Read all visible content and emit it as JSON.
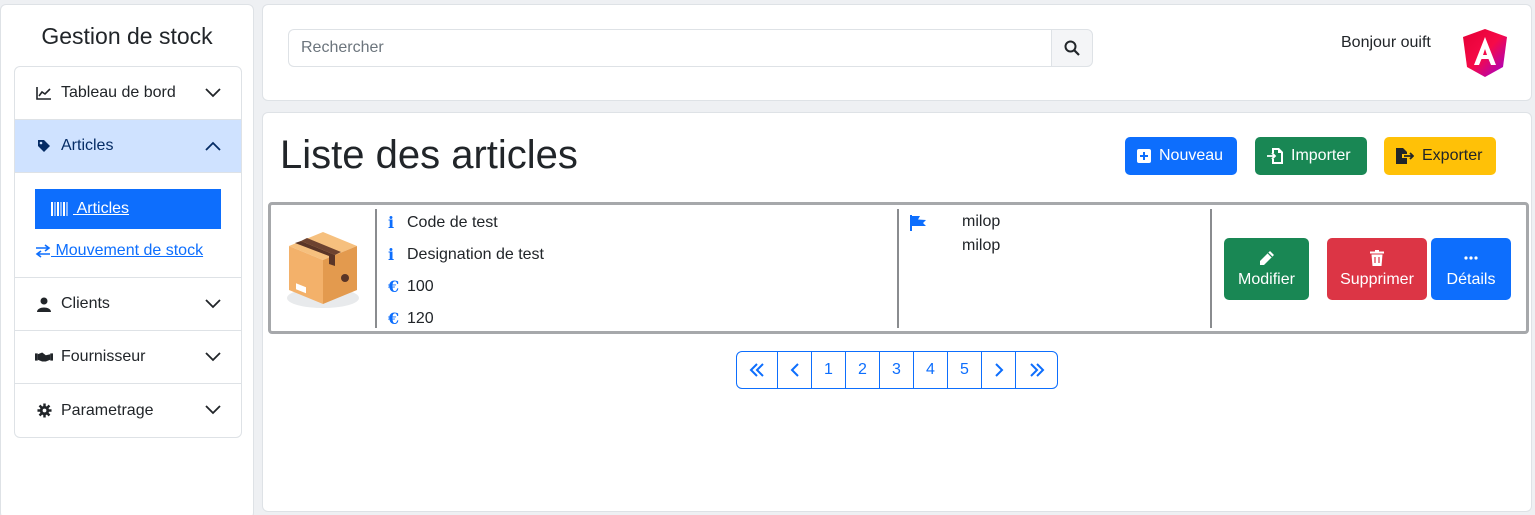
{
  "sidebar": {
    "brand": "Gestion de stock",
    "items": [
      {
        "label": "Tableau de bord"
      },
      {
        "label": "Articles"
      },
      {
        "label": "Clients"
      },
      {
        "label": "Fournisseur"
      },
      {
        "label": "Parametrage"
      }
    ],
    "sub": {
      "active_label": " Articles",
      "movement_label": " Mouvement de stock"
    }
  },
  "header": {
    "search_placeholder": "Rechercher",
    "greeting": "Bonjour ouift"
  },
  "main": {
    "title": "Liste des articles",
    "buttons": {
      "new": "Nouveau",
      "import": "Importer",
      "export": "Exporter"
    },
    "article": {
      "code": "Code de test",
      "designation": "Designation de test",
      "price1": "100",
      "price2": "120",
      "supplier1": "milop",
      "supplier2": "milop",
      "actions": {
        "edit": "Modifier",
        "delete": "Supprimer",
        "details": "Détails"
      }
    },
    "pagination": [
      "1",
      "2",
      "3",
      "4",
      "5"
    ]
  },
  "colors": {
    "primary": "#0d6efd",
    "success": "#198754",
    "warning": "#ffc107",
    "danger": "#dc3545",
    "active_bg": "#cfe2ff"
  }
}
